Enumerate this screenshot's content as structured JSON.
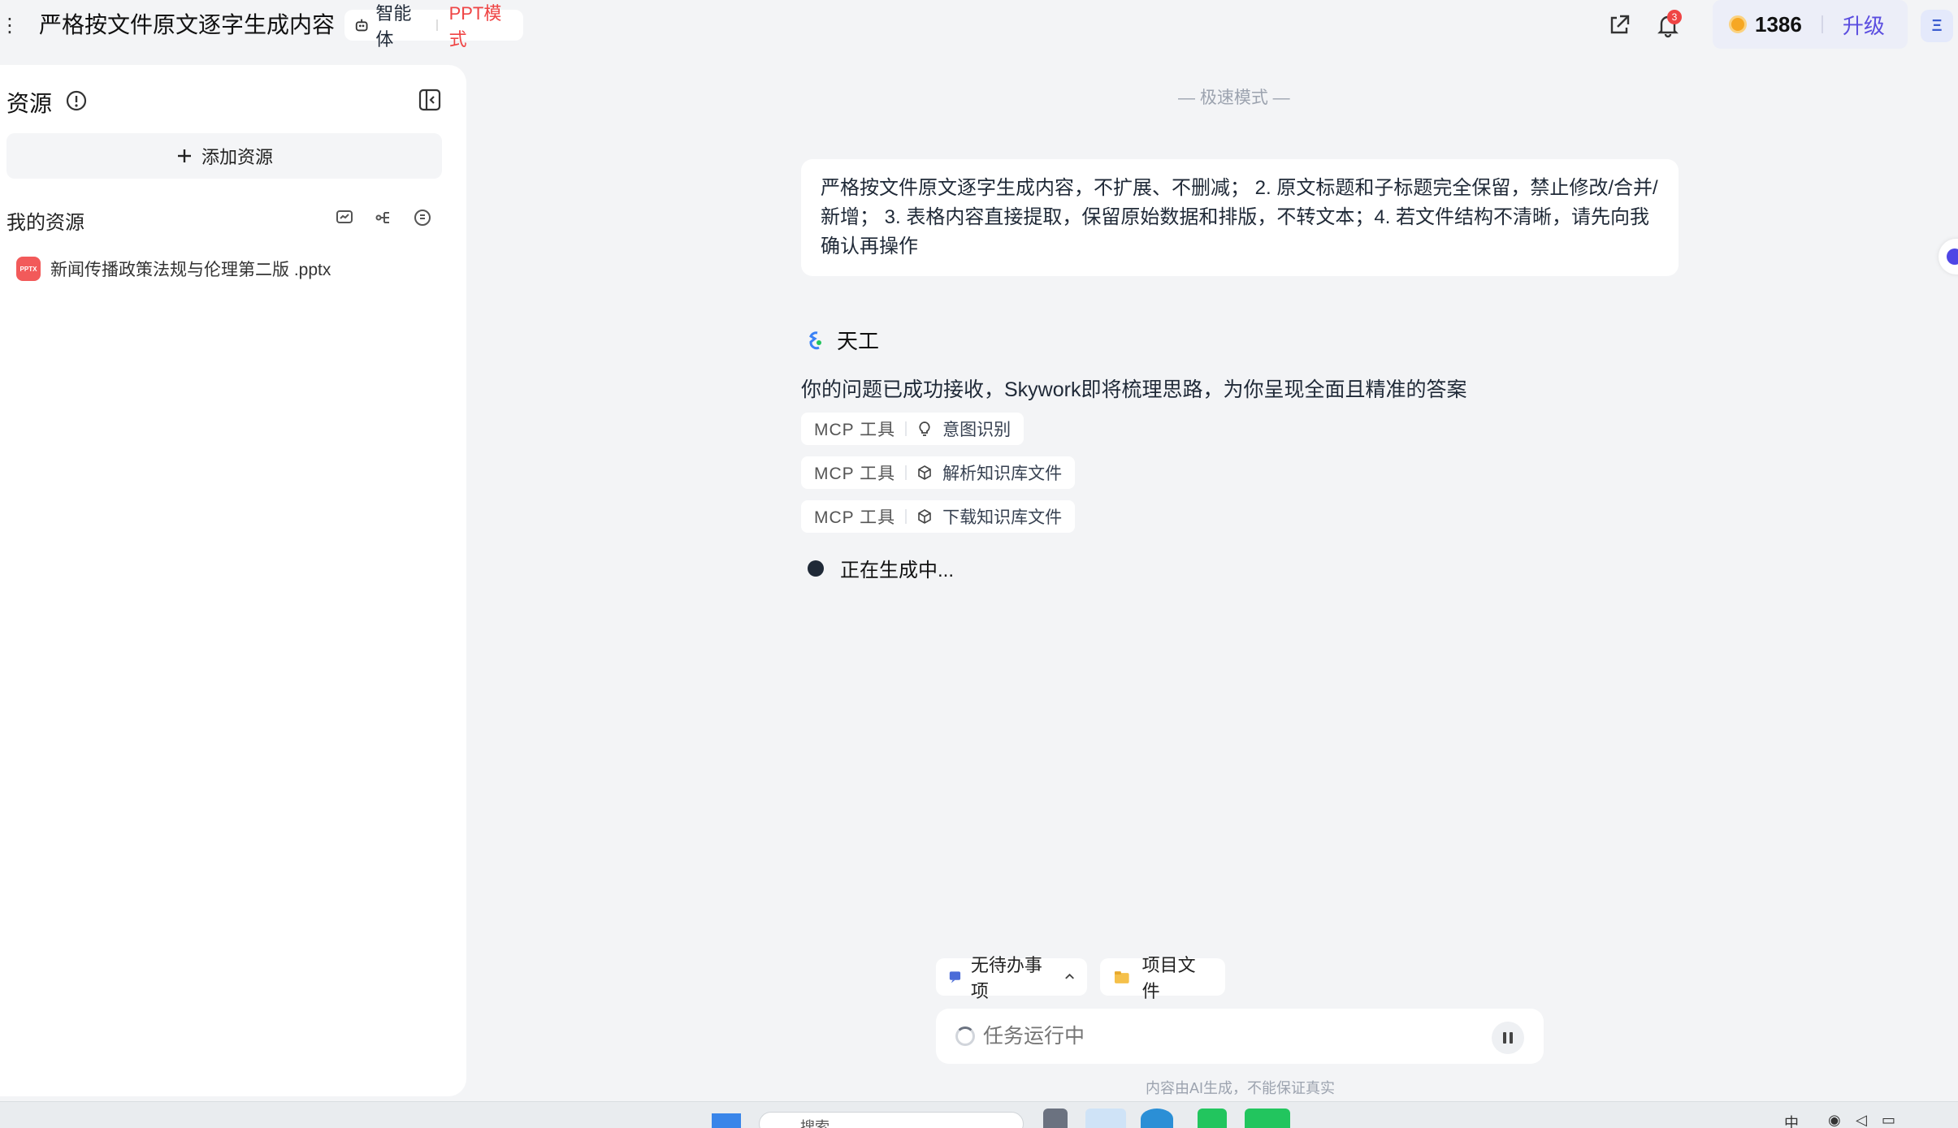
{
  "header": {
    "title": "严格按文件原文逐字生成内容",
    "agent_label": "智能体",
    "mode_label": "PPT模式",
    "notification_count": "3",
    "credits": "1386",
    "upgrade_label": "升级"
  },
  "sidebar": {
    "title": "资源",
    "add_resource": "添加资源",
    "my_resources": "我的资源",
    "files": [
      {
        "icon_text": "PPTX",
        "name": "新闻传播政策法规与伦理第二版 .pptx"
      }
    ]
  },
  "chat": {
    "mode_banner": "— 极速模式 —",
    "user_message": "严格按文件原文逐字生成内容，不扩展、不删减； 2. 原文标题和子标题完全保留，禁止修改/合并/新增； 3. 表格内容直接提取，保留原始数据和排版，不转文本；4. 若文件结构不清晰，请先向我确认再操作",
    "bot_name": "天工",
    "bot_reply": "你的问题已成功接收，Skywork即将梳理思路，为你呈现全面且精准的答案",
    "tools": [
      {
        "tag": "MCP 工具",
        "label": "意图识别"
      },
      {
        "tag": "MCP 工具",
        "label": "解析知识库文件"
      },
      {
        "tag": "MCP 工具",
        "label": "下载知识库文件"
      }
    ],
    "status": "正在生成中..."
  },
  "composer": {
    "todo_label": "无待办事项",
    "project_files_label": "项目文件",
    "placeholder": "任务运行中",
    "disclaimer": "内容由AI生成，不能保证真实"
  },
  "taskbar": {
    "search_placeholder": "搜索",
    "tray_ime": "中"
  },
  "colors": {
    "accent": "#5b4ee0",
    "ppt_mode": "#ef4444",
    "background": "#f3f4f6"
  }
}
